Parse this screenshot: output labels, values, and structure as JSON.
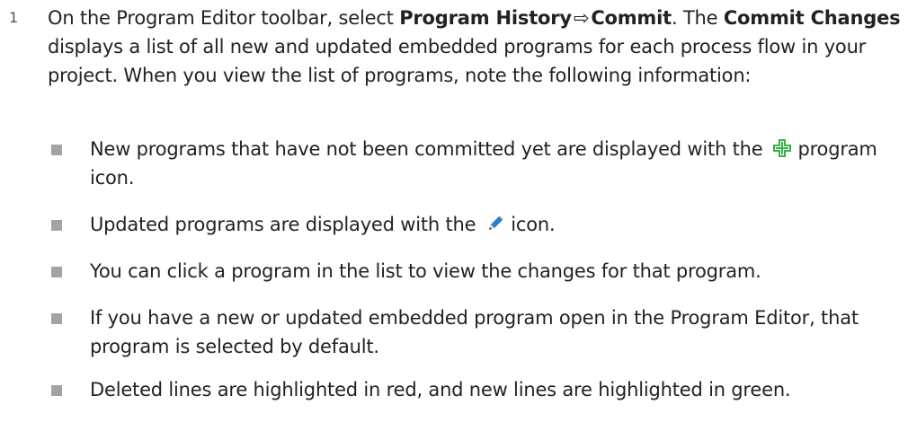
{
  "step": {
    "number": "1",
    "line1_pre": "On the Program Editor toolbar, select ",
    "menu_path_1": "Program History",
    "arrow": "⇨",
    "menu_path_2": "Commit",
    "line1_mid": ". The ",
    "dialog_name": "Commit Changes",
    "line1_post": " displays a list of all new and updated embedded programs for each process flow in your project. When you view the list of programs, note the following information:"
  },
  "bullets": [
    {
      "text_pre": "New programs that have not been committed yet are displayed with the ",
      "icon": "green-plus-icon",
      "text_post": " program icon."
    },
    {
      "text_pre": "Updated programs are displayed with the ",
      "icon": "pencil-edit-icon",
      "text_post": " icon."
    },
    {
      "text": "You can click a program in the list to view the changes for that program."
    },
    {
      "text": "If you have a new or updated embedded program open in the Program Editor, that program is selected by default."
    },
    {
      "text": "Deleted lines are highlighted in red, and new lines are highlighted in green."
    }
  ],
  "colors": {
    "text": "#222222",
    "bullet_square": "#a3a3a3",
    "plus_icon": "#3cb043",
    "pencil_icon": "#1e7fd8"
  }
}
